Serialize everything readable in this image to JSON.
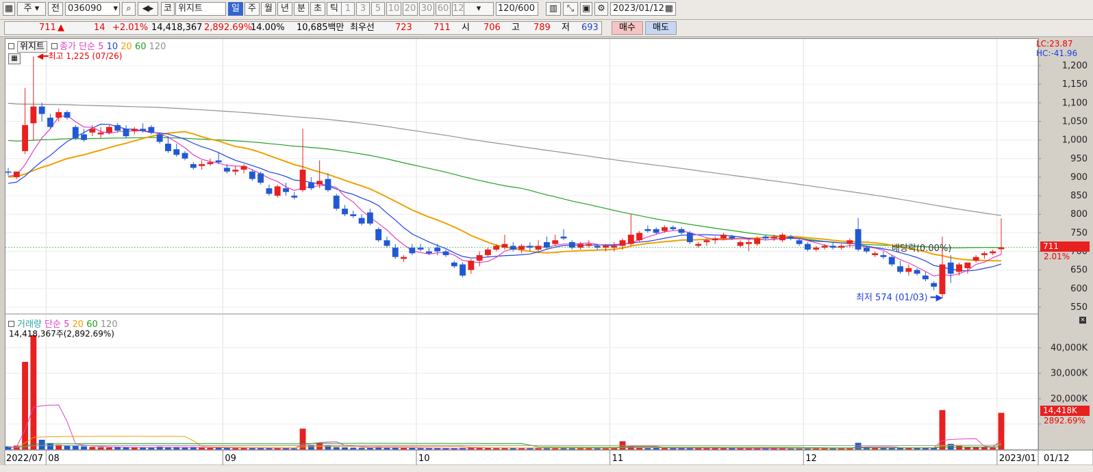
{
  "toolbar": {
    "period_code": "주",
    "prev_label": "전",
    "stock_code": "036090",
    "market_tag": "코",
    "stock_name": "위지트",
    "period_buttons": [
      "일",
      "주",
      "월",
      "년",
      "분",
      "초",
      "틱"
    ],
    "active_period": "일",
    "interval_buttons": [
      "1",
      "3",
      "5",
      "10",
      "20",
      "30",
      "60",
      "120"
    ],
    "count_value": "120",
    "count_total": "/600",
    "date_value": "2023/01/12"
  },
  "infobar": {
    "price": "711",
    "change_arrow": "▲",
    "change": "14",
    "change_rate": "+2.01%",
    "volume": "14,418,367",
    "volume_rate": "2,892.69%",
    "turnover": "14.00%",
    "amount": "10,685백만",
    "best_label": "최우선",
    "ask": "723",
    "bid": "711",
    "open_label": "시",
    "open": "706",
    "high_label": "고",
    "high": "789",
    "low_label": "저",
    "low": "693",
    "buy_label": "매수",
    "sell_label": "매도"
  },
  "price_panel": {
    "name_tag": "위지트",
    "legend_title": "종가 단순",
    "ma_labels": [
      "5",
      "10",
      "20",
      "60",
      "120"
    ],
    "ma_colors": [
      "#e040c0",
      "#2040e0",
      "#f0a000",
      "#20a020",
      "#909090"
    ],
    "lc_label": "LC:23.87",
    "hc_label": "HC:-41.96",
    "max_label": "최고 1,225 (07/26)",
    "min_label": "최저 574 (01/03)",
    "dividend_label": "배당락(0.00%)",
    "current_tag": "711",
    "current_rate": "2.01%"
  },
  "volume_panel": {
    "legend_title": "거래량",
    "legend_sub": "단순",
    "ma_labels": [
      "5",
      "20",
      "60",
      "120"
    ],
    "volume_text": "14,418,367주(2,892.69%)",
    "current_tag": "14,418K",
    "current_rate": "2892.69%"
  },
  "x_axis": {
    "labels": [
      "2022/07",
      "08",
      "09",
      "10",
      "11",
      "12",
      "2023/01"
    ],
    "right_label": "01/12"
  },
  "chart_data": {
    "type": "candlestick",
    "price_axis": {
      "ylim": [
        550,
        1200
      ],
      "ticks": [
        550,
        600,
        650,
        700,
        750,
        800,
        850,
        900,
        950,
        1000,
        1050,
        1100,
        1150,
        1200
      ]
    },
    "volume_axis": {
      "ylim": [
        0,
        45000
      ],
      "ticks": [
        10000,
        20000,
        30000,
        40000
      ],
      "tick_labels": [
        "",
        "20,000K",
        "30,000K",
        "40,000K"
      ]
    },
    "candles": [
      {
        "o": 915,
        "h": 925,
        "l": 905,
        "c": 912
      },
      {
        "o": 900,
        "h": 910,
        "l": 895,
        "c": 915
      },
      {
        "o": 970,
        "h": 1140,
        "l": 962,
        "c": 1040
      },
      {
        "o": 1045,
        "h": 1225,
        "l": 1000,
        "c": 1090
      },
      {
        "o": 1090,
        "h": 1100,
        "l": 1050,
        "c": 1070
      },
      {
        "o": 1060,
        "h": 1070,
        "l": 1030,
        "c": 1035
      },
      {
        "o": 1060,
        "h": 1085,
        "l": 1050,
        "c": 1075
      },
      {
        "o": 1075,
        "h": 1080,
        "l": 1055,
        "c": 1060
      },
      {
        "o": 1035,
        "h": 1040,
        "l": 1000,
        "c": 1005
      },
      {
        "o": 1015,
        "h": 1030,
        "l": 995,
        "c": 1000
      },
      {
        "o": 1020,
        "h": 1040,
        "l": 1010,
        "c": 1030
      },
      {
        "o": 1015,
        "h": 1035,
        "l": 1005,
        "c": 1020
      },
      {
        "o": 1020,
        "h": 1040,
        "l": 1015,
        "c": 1035
      },
      {
        "o": 1040,
        "h": 1045,
        "l": 1020,
        "c": 1025
      },
      {
        "o": 1030,
        "h": 1040,
        "l": 1005,
        "c": 1010
      },
      {
        "o": 1025,
        "h": 1035,
        "l": 1015,
        "c": 1030
      },
      {
        "o": 1030,
        "h": 1045,
        "l": 1020,
        "c": 1025
      },
      {
        "o": 1035,
        "h": 1040,
        "l": 1015,
        "c": 1020
      },
      {
        "o": 1015,
        "h": 1020,
        "l": 990,
        "c": 995
      },
      {
        "o": 990,
        "h": 1010,
        "l": 965,
        "c": 970
      },
      {
        "o": 975,
        "h": 990,
        "l": 955,
        "c": 960
      },
      {
        "o": 965,
        "h": 970,
        "l": 945,
        "c": 950
      },
      {
        "o": 935,
        "h": 940,
        "l": 920,
        "c": 925
      },
      {
        "o": 930,
        "h": 945,
        "l": 920,
        "c": 935
      },
      {
        "o": 935,
        "h": 950,
        "l": 930,
        "c": 940
      },
      {
        "o": 945,
        "h": 965,
        "l": 935,
        "c": 940
      },
      {
        "o": 925,
        "h": 935,
        "l": 910,
        "c": 915
      },
      {
        "o": 915,
        "h": 930,
        "l": 905,
        "c": 920
      },
      {
        "o": 920,
        "h": 935,
        "l": 910,
        "c": 930
      },
      {
        "o": 915,
        "h": 920,
        "l": 890,
        "c": 895
      },
      {
        "o": 910,
        "h": 915,
        "l": 880,
        "c": 885
      },
      {
        "o": 870,
        "h": 880,
        "l": 850,
        "c": 855
      },
      {
        "o": 850,
        "h": 880,
        "l": 845,
        "c": 875
      },
      {
        "o": 870,
        "h": 885,
        "l": 850,
        "c": 860
      },
      {
        "o": 850,
        "h": 860,
        "l": 840,
        "c": 845
      },
      {
        "o": 865,
        "h": 1030,
        "l": 860,
        "c": 920
      },
      {
        "o": 885,
        "h": 900,
        "l": 865,
        "c": 870
      },
      {
        "o": 880,
        "h": 945,
        "l": 870,
        "c": 890
      },
      {
        "o": 895,
        "h": 910,
        "l": 860,
        "c": 865
      },
      {
        "o": 850,
        "h": 855,
        "l": 810,
        "c": 815
      },
      {
        "o": 815,
        "h": 825,
        "l": 795,
        "c": 800
      },
      {
        "o": 800,
        "h": 810,
        "l": 790,
        "c": 795
      },
      {
        "o": 790,
        "h": 800,
        "l": 770,
        "c": 775
      },
      {
        "o": 805,
        "h": 815,
        "l": 770,
        "c": 775
      },
      {
        "o": 760,
        "h": 765,
        "l": 725,
        "c": 730
      },
      {
        "o": 730,
        "h": 740,
        "l": 710,
        "c": 715
      },
      {
        "o": 710,
        "h": 720,
        "l": 680,
        "c": 685
      },
      {
        "o": 680,
        "h": 690,
        "l": 672,
        "c": 685
      },
      {
        "o": 710,
        "h": 720,
        "l": 690,
        "c": 695
      },
      {
        "o": 710,
        "h": 720,
        "l": 700,
        "c": 705
      },
      {
        "o": 700,
        "h": 710,
        "l": 690,
        "c": 695
      },
      {
        "o": 710,
        "h": 720,
        "l": 690,
        "c": 700
      },
      {
        "o": 700,
        "h": 705,
        "l": 685,
        "c": 690
      },
      {
        "o": 670,
        "h": 675,
        "l": 655,
        "c": 660
      },
      {
        "o": 665,
        "h": 670,
        "l": 630,
        "c": 635
      },
      {
        "o": 650,
        "h": 680,
        "l": 640,
        "c": 675
      },
      {
        "o": 675,
        "h": 700,
        "l": 660,
        "c": 690
      },
      {
        "o": 690,
        "h": 710,
        "l": 685,
        "c": 705
      },
      {
        "o": 705,
        "h": 720,
        "l": 700,
        "c": 715
      },
      {
        "o": 710,
        "h": 745,
        "l": 705,
        "c": 720
      },
      {
        "o": 715,
        "h": 725,
        "l": 700,
        "c": 705
      },
      {
        "o": 705,
        "h": 720,
        "l": 695,
        "c": 715
      },
      {
        "o": 715,
        "h": 725,
        "l": 700,
        "c": 710
      },
      {
        "o": 705,
        "h": 730,
        "l": 700,
        "c": 715
      },
      {
        "o": 725,
        "h": 740,
        "l": 705,
        "c": 710
      },
      {
        "o": 720,
        "h": 745,
        "l": 715,
        "c": 730
      },
      {
        "o": 740,
        "h": 760,
        "l": 730,
        "c": 735
      },
      {
        "o": 725,
        "h": 730,
        "l": 705,
        "c": 710
      },
      {
        "o": 710,
        "h": 725,
        "l": 705,
        "c": 720
      },
      {
        "o": 715,
        "h": 730,
        "l": 710,
        "c": 720
      },
      {
        "o": 715,
        "h": 720,
        "l": 705,
        "c": 710
      },
      {
        "o": 710,
        "h": 720,
        "l": 700,
        "c": 715
      },
      {
        "o": 710,
        "h": 725,
        "l": 700,
        "c": 715
      },
      {
        "o": 715,
        "h": 735,
        "l": 705,
        "c": 730
      },
      {
        "o": 720,
        "h": 800,
        "l": 715,
        "c": 745
      },
      {
        "o": 730,
        "h": 755,
        "l": 725,
        "c": 750
      },
      {
        "o": 760,
        "h": 770,
        "l": 750,
        "c": 755
      },
      {
        "o": 760,
        "h": 765,
        "l": 745,
        "c": 750
      },
      {
        "o": 755,
        "h": 770,
        "l": 750,
        "c": 765
      },
      {
        "o": 765,
        "h": 770,
        "l": 755,
        "c": 760
      },
      {
        "o": 760,
        "h": 765,
        "l": 745,
        "c": 750
      },
      {
        "o": 750,
        "h": 755,
        "l": 720,
        "c": 725
      },
      {
        "o": 715,
        "h": 725,
        "l": 710,
        "c": 720
      },
      {
        "o": 725,
        "h": 735,
        "l": 715,
        "c": 730
      },
      {
        "o": 730,
        "h": 740,
        "l": 720,
        "c": 735
      },
      {
        "o": 735,
        "h": 750,
        "l": 730,
        "c": 745
      },
      {
        "o": 740,
        "h": 745,
        "l": 730,
        "c": 735
      },
      {
        "o": 715,
        "h": 730,
        "l": 710,
        "c": 725
      },
      {
        "o": 720,
        "h": 735,
        "l": 700,
        "c": 725
      },
      {
        "o": 720,
        "h": 740,
        "l": 715,
        "c": 735
      },
      {
        "o": 740,
        "h": 745,
        "l": 730,
        "c": 735
      },
      {
        "o": 735,
        "h": 745,
        "l": 728,
        "c": 740
      },
      {
        "o": 730,
        "h": 750,
        "l": 725,
        "c": 745
      },
      {
        "o": 740,
        "h": 745,
        "l": 730,
        "c": 735
      },
      {
        "o": 730,
        "h": 735,
        "l": 715,
        "c": 720
      },
      {
        "o": 720,
        "h": 725,
        "l": 700,
        "c": 705
      },
      {
        "o": 705,
        "h": 715,
        "l": 700,
        "c": 710
      },
      {
        "o": 710,
        "h": 720,
        "l": 705,
        "c": 715
      },
      {
        "o": 715,
        "h": 725,
        "l": 705,
        "c": 710
      },
      {
        "o": 710,
        "h": 720,
        "l": 705,
        "c": 715
      },
      {
        "o": 720,
        "h": 735,
        "l": 710,
        "c": 730
      },
      {
        "o": 760,
        "h": 790,
        "l": 700,
        "c": 705
      },
      {
        "o": 710,
        "h": 715,
        "l": 695,
        "c": 700
      },
      {
        "o": 690,
        "h": 700,
        "l": 685,
        "c": 695
      },
      {
        "o": 690,
        "h": 700,
        "l": 680,
        "c": 685
      },
      {
        "o": 685,
        "h": 690,
        "l": 660,
        "c": 665
      },
      {
        "o": 660,
        "h": 675,
        "l": 640,
        "c": 645
      },
      {
        "o": 645,
        "h": 665,
        "l": 635,
        "c": 655
      },
      {
        "o": 650,
        "h": 655,
        "l": 635,
        "c": 640
      },
      {
        "o": 635,
        "h": 645,
        "l": 620,
        "c": 625
      },
      {
        "o": 615,
        "h": 620,
        "l": 595,
        "c": 605
      },
      {
        "o": 585,
        "h": 740,
        "l": 574,
        "c": 665
      },
      {
        "o": 670,
        "h": 690,
        "l": 615,
        "c": 640
      },
      {
        "o": 645,
        "h": 670,
        "l": 635,
        "c": 665
      },
      {
        "o": 655,
        "h": 670,
        "l": 640,
        "c": 670
      },
      {
        "o": 675,
        "h": 690,
        "l": 670,
        "c": 685
      },
      {
        "o": 690,
        "h": 700,
        "l": 680,
        "c": 695
      },
      {
        "o": 695,
        "h": 705,
        "l": 690,
        "c": 700
      },
      {
        "o": 706,
        "h": 789,
        "l": 693,
        "c": 711
      }
    ],
    "volume": [
      1200,
      1500,
      34500,
      45000,
      3800,
      2500,
      1800,
      1600,
      1400,
      1200,
      1000,
      900,
      800,
      900,
      800,
      700,
      800,
      700,
      1100,
      900,
      800,
      700,
      800,
      700,
      600,
      700,
      600,
      500,
      600,
      500,
      600,
      500,
      400,
      500,
      400,
      8200,
      1800,
      2600,
      1700,
      900,
      800,
      700,
      600,
      600,
      900,
      800,
      700,
      600,
      600,
      500,
      500,
      500,
      400,
      500,
      700,
      800,
      700,
      600,
      500,
      500,
      600,
      500,
      500,
      400,
      700,
      600,
      500,
      500,
      600,
      500,
      400,
      500,
      700,
      3200,
      1200,
      600,
      500,
      600,
      500,
      400,
      500,
      500,
      600,
      500,
      500,
      500,
      400,
      400,
      400,
      400,
      500,
      400,
      500,
      400,
      400,
      400,
      600,
      500,
      500,
      400,
      500,
      2600,
      900,
      700,
      600,
      500,
      600,
      500,
      500,
      600,
      700,
      15500,
      2200,
      1400,
      1000,
      900,
      800,
      700,
      14418
    ]
  }
}
